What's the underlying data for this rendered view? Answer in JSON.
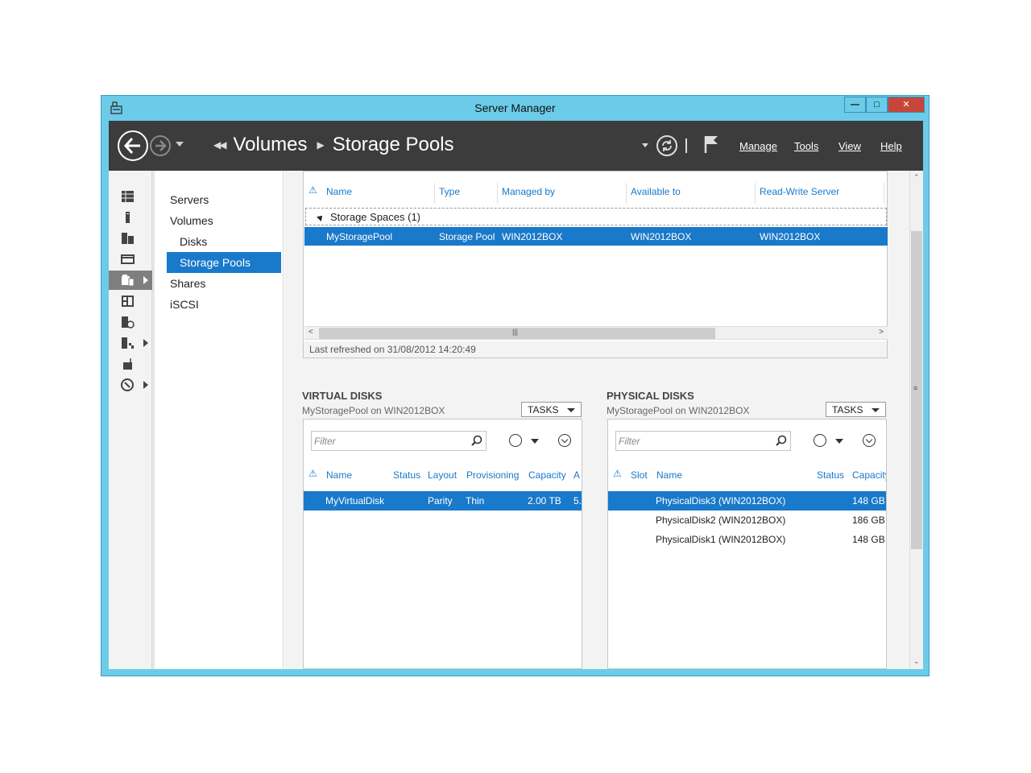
{
  "window": {
    "title": "Server Manager"
  },
  "navbar": {
    "breadcrumb": [
      "Volumes",
      "Storage Pools"
    ],
    "menu": {
      "manage": "Manage",
      "tools": "Tools",
      "view": "View",
      "help": "Help"
    }
  },
  "sidenav": {
    "items": [
      {
        "label": "Servers"
      },
      {
        "label": "Volumes"
      },
      {
        "label": "Disks"
      },
      {
        "label": "Storage Pools"
      },
      {
        "label": "Shares"
      },
      {
        "label": "iSCSI"
      }
    ]
  },
  "storage_pools": {
    "columns": [
      "Name",
      "Type",
      "Managed by",
      "Available to",
      "Read-Write Server"
    ],
    "group_label": "Storage Spaces (1)",
    "rows": [
      {
        "name": "MyStoragePool",
        "type": "Storage Pool",
        "managed_by": "WIN2012BOX",
        "available_to": "WIN2012BOX",
        "rw_server": "WIN2012BOX"
      }
    ],
    "status": "Last refreshed on 31/08/2012 14:20:49"
  },
  "virtual_disks": {
    "title": "VIRTUAL DISKS",
    "subtitle": "MyStoragePool on WIN2012BOX",
    "tasks_label": "TASKS",
    "filter_placeholder": "Filter",
    "columns": [
      "Name",
      "Status",
      "Layout",
      "Provisioning",
      "Capacity",
      "A"
    ],
    "rows": [
      {
        "name": "MyVirtualDisk",
        "status": "",
        "layout": "Parity",
        "provisioning": "Thin",
        "capacity": "2.00 TB",
        "allocated": "5."
      }
    ]
  },
  "physical_disks": {
    "title": "PHYSICAL DISKS",
    "subtitle": "MyStoragePool on WIN2012BOX",
    "tasks_label": "TASKS",
    "filter_placeholder": "Filter",
    "columns": [
      "Slot",
      "Name",
      "Status",
      "Capacity"
    ],
    "rows": [
      {
        "name": "PhysicalDisk3 (WIN2012BOX)",
        "capacity": "148 GB",
        "selected": true
      },
      {
        "name": "PhysicalDisk2 (WIN2012BOX)",
        "capacity": "186 GB",
        "selected": false
      },
      {
        "name": "PhysicalDisk1 (WIN2012BOX)",
        "capacity": "148 GB",
        "selected": false
      }
    ]
  },
  "colors": {
    "titlebar": "#6ccbe8",
    "selection": "#1979ca",
    "navbar": "#3c3c3c",
    "close_button": "#c7463a"
  },
  "icons": [
    "back-icon",
    "forward-icon",
    "refresh-icon",
    "flag-icon",
    "dashboard-icon",
    "local-server-icon",
    "all-servers-icon",
    "file-storage-icon",
    "search-icon",
    "warning-icon"
  ]
}
